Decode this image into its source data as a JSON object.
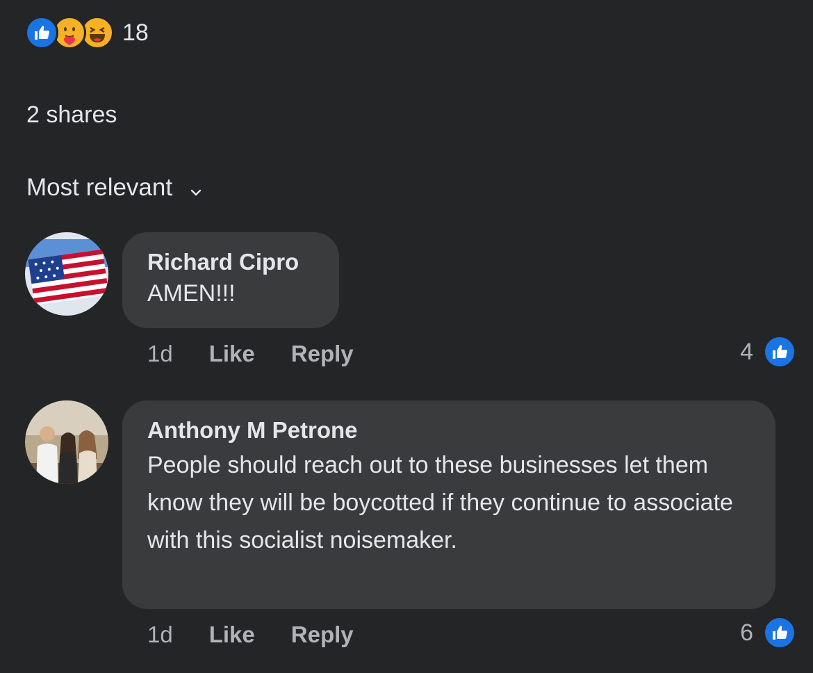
{
  "reactions": {
    "icons": [
      "like-icon",
      "care-icon",
      "haha-icon"
    ],
    "count": "18"
  },
  "shares": "2 shares",
  "sort": {
    "label": "Most relevant"
  },
  "comments": [
    {
      "author": "Richard Cipro",
      "text": "AMEN!!!",
      "time": "1d",
      "like_label": "Like",
      "reply_label": "Reply",
      "like_count": "4"
    },
    {
      "author": "Anthony M Petrone",
      "text": "People should reach out to these businesses let them know they will be boycotted if they continue to associate with this socialist noisemaker.",
      "time": "1d",
      "like_label": "Like",
      "reply_label": "Reply",
      "like_count": "6"
    }
  ],
  "colors": {
    "background": "#242526",
    "bubble": "#3a3b3c",
    "text": "#e4e6eb",
    "muted": "#b0b3b8",
    "like_blue": "#1b74e4",
    "emoji_yellow": "#f7b125"
  }
}
